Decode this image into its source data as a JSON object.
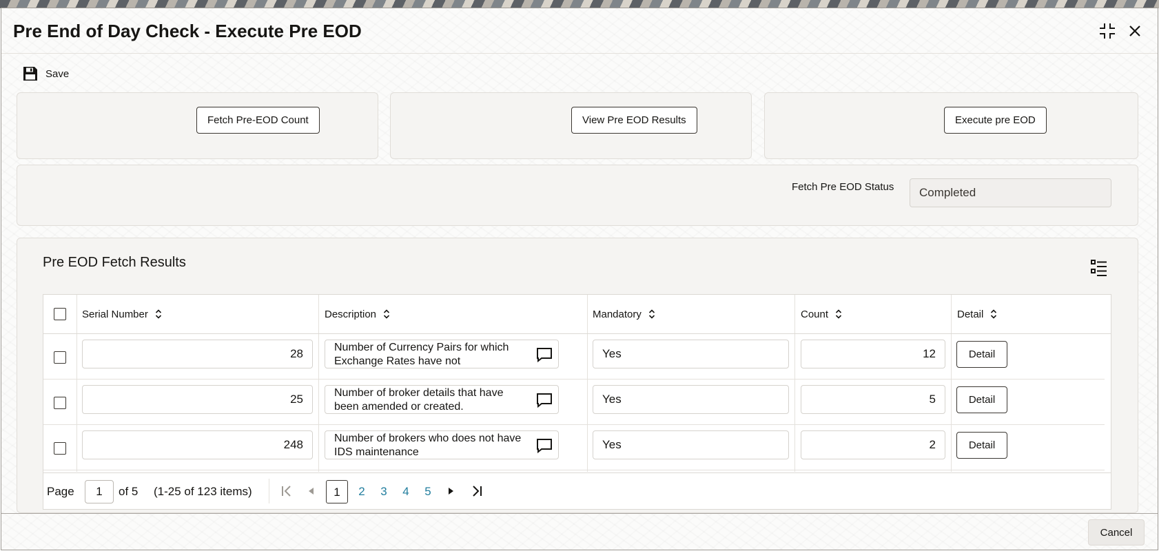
{
  "window": {
    "title": "Pre End of Day Check - Execute Pre EOD"
  },
  "toolbar": {
    "save_label": "Save"
  },
  "actions": {
    "fetch_count_label": "Fetch Pre-EOD Count",
    "view_results_label": "View Pre EOD Results",
    "execute_label": "Execute pre EOD"
  },
  "status": {
    "label": "Fetch Pre EOD Status",
    "value": "Completed"
  },
  "results": {
    "title": "Pre EOD Fetch Results",
    "columns": {
      "serial": "Serial Number",
      "description": "Description",
      "mandatory": "Mandatory",
      "count": "Count",
      "detail": "Detail"
    },
    "rows": [
      {
        "serial": "28",
        "description": "Number of Currency Pairs for which Exchange Rates have not",
        "mandatory": "Yes",
        "count": "12",
        "detail_label": "Detail"
      },
      {
        "serial": "25",
        "description": "Number of broker details that have been amended or created.",
        "mandatory": "Yes",
        "count": "5",
        "detail_label": "Detail"
      },
      {
        "serial": "248",
        "description": "Number of brokers who does not have IDS maintenance",
        "mandatory": "Yes",
        "count": "2",
        "detail_label": "Detail"
      }
    ]
  },
  "pagination": {
    "page_label": "Page",
    "current_page": "1",
    "of_label": "of 5",
    "range_label": "(1-25 of 123 items)",
    "pages": [
      "1",
      "2",
      "3",
      "4",
      "5"
    ]
  },
  "footer": {
    "cancel_label": "Cancel"
  },
  "colors": {
    "panel_bg": "#f5f4f2",
    "text": "#161513",
    "link": "#227e9e"
  }
}
